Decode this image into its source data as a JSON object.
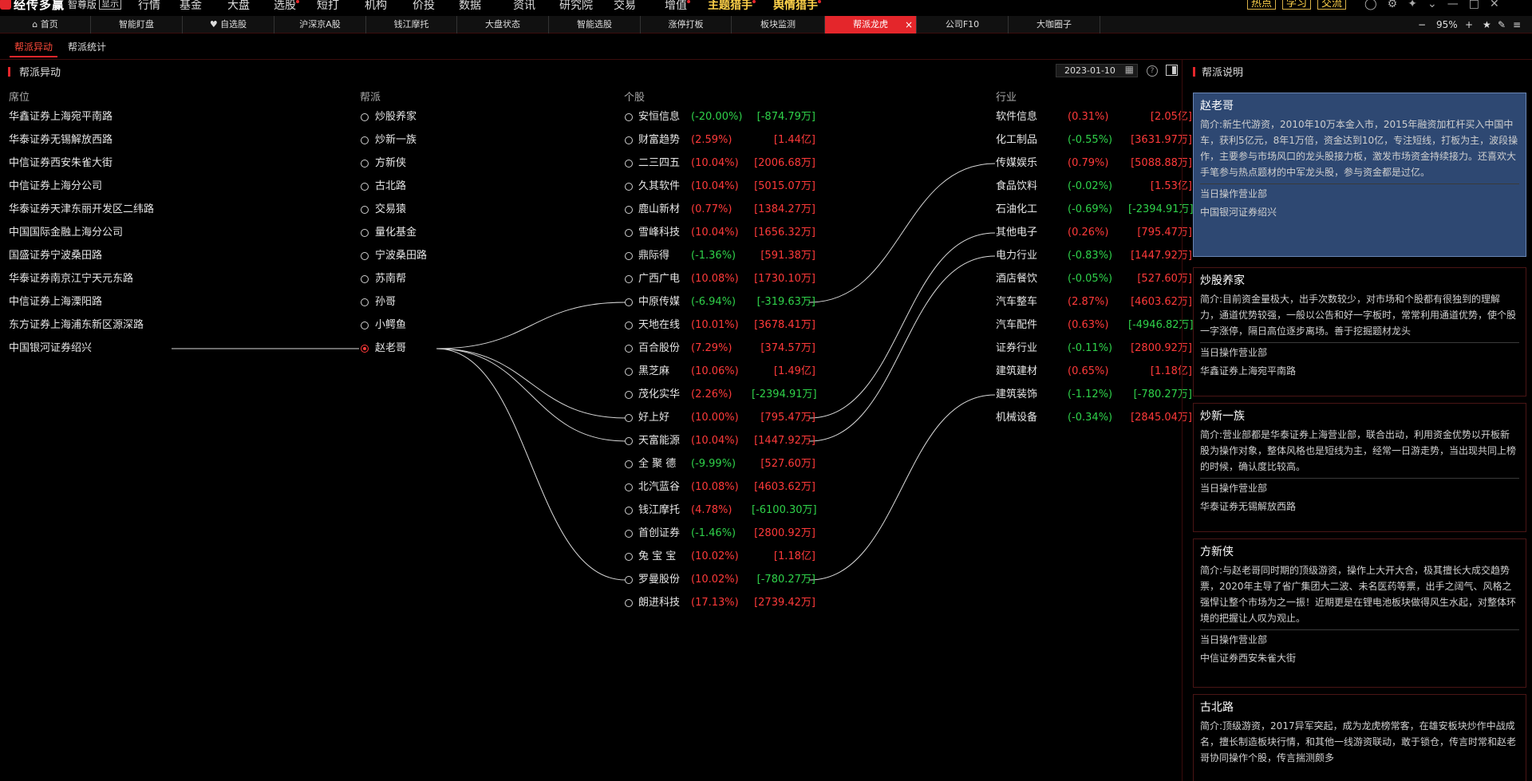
{
  "app": {
    "name": "经传多赢",
    "edition": "智尊版",
    "switch_label": "显示",
    "menu": [
      "行情",
      "基金",
      "大盘",
      "选股",
      "短打",
      "机构",
      "价投",
      "数据",
      "资讯",
      "研究院",
      "交易",
      "增值",
      "主题猎手",
      "舆情猎手"
    ],
    "right_buttons": [
      "热点",
      "学习",
      "交流"
    ],
    "window_icons": [
      "user-icon",
      "settings-icon",
      "pin-icon",
      "minimize-icon",
      "maximize-icon",
      "close-icon"
    ]
  },
  "tabs": [
    "首页",
    "智能盯盘",
    "自选股",
    "沪深京A股",
    "钱江摩托",
    "大盘状态",
    "智能选股",
    "涨停打板",
    "板块监测",
    "帮派龙虎",
    "公司F10",
    "大咖圈子"
  ],
  "active_tab": "帮派龙虎",
  "tab_controls": {
    "minus": "−",
    "zoom": "95%",
    "plus": "+"
  },
  "subtabs": [
    "帮派异动",
    "帮派统计"
  ],
  "panel": {
    "title": "帮派异动",
    "date": "2023-01-10",
    "columns": {
      "seat": "席位",
      "gang": "帮派",
      "stock": "个股",
      "industry": "行业"
    }
  },
  "seats": [
    "华鑫证券上海宛平南路",
    "华泰证券无锡解放西路",
    "中信证券西安朱雀大街",
    "中信证券上海分公司",
    "华泰证券天津东丽开发区二纬路",
    "中国国际金融上海分公司",
    "国盛证券宁波桑田路",
    "华泰证券南京江宁天元东路",
    "中信证券上海溧阳路",
    "东方证券上海浦东新区源深路",
    "中国银河证券绍兴"
  ],
  "gangs": [
    {
      "name": "炒股养家",
      "selected": false
    },
    {
      "name": "炒新一族",
      "selected": false
    },
    {
      "name": "方新侠",
      "selected": false
    },
    {
      "name": "古北路",
      "selected": false
    },
    {
      "name": "交易猿",
      "selected": false
    },
    {
      "name": "量化基金",
      "selected": false
    },
    {
      "name": "宁波桑田路",
      "selected": false
    },
    {
      "name": "苏南帮",
      "selected": false
    },
    {
      "name": "孙哥",
      "selected": false
    },
    {
      "name": "小鳄鱼",
      "selected": false
    },
    {
      "name": "赵老哥",
      "selected": true
    }
  ],
  "stocks": [
    {
      "name": "安恒信息",
      "pct": "(-20.00%)",
      "amt": "[-874.79万]",
      "pct_color": "green",
      "amt_color": "green"
    },
    {
      "name": "财富趋势",
      "pct": "(2.59%)",
      "amt": "[1.44亿]",
      "pct_color": "red",
      "amt_color": "red"
    },
    {
      "name": "二三四五",
      "pct": "(10.04%)",
      "amt": "[2006.68万]",
      "pct_color": "red",
      "amt_color": "red"
    },
    {
      "name": "久其软件",
      "pct": "(10.04%)",
      "amt": "[5015.07万]",
      "pct_color": "red",
      "amt_color": "red"
    },
    {
      "name": "鹿山新材",
      "pct": "(0.77%)",
      "amt": "[1384.27万]",
      "pct_color": "red",
      "amt_color": "red"
    },
    {
      "name": "雪峰科技",
      "pct": "(10.04%)",
      "amt": "[1656.32万]",
      "pct_color": "red",
      "amt_color": "red"
    },
    {
      "name": "鼎际得",
      "pct": "(-1.36%)",
      "amt": "[591.38万]",
      "pct_color": "green",
      "amt_color": "red"
    },
    {
      "name": "广西广电",
      "pct": "(10.08%)",
      "amt": "[1730.10万]",
      "pct_color": "red",
      "amt_color": "red"
    },
    {
      "name": "中原传媒",
      "pct": "(-6.94%)",
      "amt": "[-319.63万]",
      "pct_color": "green",
      "amt_color": "green"
    },
    {
      "name": "天地在线",
      "pct": "(10.01%)",
      "amt": "[3678.41万]",
      "pct_color": "red",
      "amt_color": "red"
    },
    {
      "name": "百合股份",
      "pct": "(7.29%)",
      "amt": "[374.57万]",
      "pct_color": "red",
      "amt_color": "red"
    },
    {
      "name": "黑芝麻",
      "pct": "(10.06%)",
      "amt": "[1.49亿]",
      "pct_color": "red",
      "amt_color": "red"
    },
    {
      "name": "茂化实华",
      "pct": "(2.26%)",
      "amt": "[-2394.91万]",
      "pct_color": "red",
      "amt_color": "green"
    },
    {
      "name": "好上好",
      "pct": "(10.00%)",
      "amt": "[795.47万]",
      "pct_color": "red",
      "amt_color": "red"
    },
    {
      "name": "天富能源",
      "pct": "(10.04%)",
      "amt": "[1447.92万]",
      "pct_color": "red",
      "amt_color": "red"
    },
    {
      "name": "全 聚 德",
      "pct": "(-9.99%)",
      "amt": "[527.60万]",
      "pct_color": "green",
      "amt_color": "red"
    },
    {
      "name": "北汽蓝谷",
      "pct": "(10.08%)",
      "amt": "[4603.62万]",
      "pct_color": "red",
      "amt_color": "red"
    },
    {
      "name": "钱江摩托",
      "pct": "(4.78%)",
      "amt": "[-6100.30万]",
      "pct_color": "red",
      "amt_color": "green"
    },
    {
      "name": "首创证券",
      "pct": "(-1.46%)",
      "amt": "[2800.92万]",
      "pct_color": "green",
      "amt_color": "red"
    },
    {
      "name": "兔 宝 宝",
      "pct": "(10.02%)",
      "amt": "[1.18亿]",
      "pct_color": "red",
      "amt_color": "red"
    },
    {
      "name": "罗曼股份",
      "pct": "(10.02%)",
      "amt": "[-780.27万]",
      "pct_color": "red",
      "amt_color": "green"
    },
    {
      "name": "朗进科技",
      "pct": "(17.13%)",
      "amt": "[2739.42万]",
      "pct_color": "red",
      "amt_color": "red"
    }
  ],
  "industries": [
    {
      "name": "软件信息",
      "pct": "(0.31%)",
      "amt": "[2.05亿]",
      "pct_color": "red",
      "amt_color": "red"
    },
    {
      "name": "化工制品",
      "pct": "(-0.55%)",
      "amt": "[3631.97万]",
      "pct_color": "green",
      "amt_color": "red"
    },
    {
      "name": "传媒娱乐",
      "pct": "(0.79%)",
      "amt": "[5088.88万]",
      "pct_color": "red",
      "amt_color": "red"
    },
    {
      "name": "食品饮料",
      "pct": "(-0.02%)",
      "amt": "[1.53亿]",
      "pct_color": "green",
      "amt_color": "red"
    },
    {
      "name": "石油化工",
      "pct": "(-0.69%)",
      "amt": "[-2394.91万]",
      "pct_color": "green",
      "amt_color": "green"
    },
    {
      "name": "其他电子",
      "pct": "(0.26%)",
      "amt": "[795.47万]",
      "pct_color": "red",
      "amt_color": "red"
    },
    {
      "name": "电力行业",
      "pct": "(-0.83%)",
      "amt": "[1447.92万]",
      "pct_color": "green",
      "amt_color": "red"
    },
    {
      "name": "酒店餐饮",
      "pct": "(-0.05%)",
      "amt": "[527.60万]",
      "pct_color": "green",
      "amt_color": "red"
    },
    {
      "name": "汽车整车",
      "pct": "(2.87%)",
      "amt": "[4603.62万]",
      "pct_color": "red",
      "amt_color": "red"
    },
    {
      "name": "汽车配件",
      "pct": "(0.63%)",
      "amt": "[-4946.82万]",
      "pct_color": "red",
      "amt_color": "green"
    },
    {
      "name": "证券行业",
      "pct": "(-0.11%)",
      "amt": "[2800.92万]",
      "pct_color": "green",
      "amt_color": "red"
    },
    {
      "name": "建筑建材",
      "pct": "(0.65%)",
      "amt": "[1.18亿]",
      "pct_color": "red",
      "amt_color": "red"
    },
    {
      "name": "建筑装饰",
      "pct": "(-1.12%)",
      "amt": "[-780.27万]",
      "pct_color": "green",
      "amt_color": "green"
    },
    {
      "name": "机械设备",
      "pct": "(-0.34%)",
      "amt": "[2845.04万]",
      "pct_color": "green",
      "amt_color": "red"
    }
  ],
  "links": {
    "seat_to_gang": [
      [
        10,
        10
      ]
    ],
    "gang_to_stock": [
      [
        10,
        8
      ],
      [
        10,
        13
      ],
      [
        10,
        14
      ],
      [
        10,
        20
      ]
    ],
    "stock_to_industry": [
      [
        8,
        2
      ],
      [
        13,
        5
      ],
      [
        14,
        6
      ],
      [
        20,
        12
      ]
    ]
  },
  "right_panel": {
    "title": "帮派说明",
    "sub_label": "当日操作营业部",
    "cards": [
      {
        "name": "赵老哥",
        "desc": "简介:新生代游资，2010年10万本金入市，2015年融资加杠杆买入中国中车，获利5亿元，8年1万倍，资金达到10亿，专注短线，打板为主，波段操作，主要参与市场风口的龙头股接力板，激发市场资金持续接力。还喜欢大手笔参与热点题材的中军龙头股，参与资金都是过亿。",
        "office": "中国银河证券绍兴",
        "selected": true
      },
      {
        "name": "炒股养家",
        "desc": "简介:目前资金量极大，出手次数较少，对市场和个股都有很独到的理解力，通道优势较强，一般以公告和好一字板时，常常利用通道优势，使个股一字涨停，隔日高位逐步离场。善于挖掘题材龙头",
        "office": "华鑫证券上海宛平南路",
        "selected": false
      },
      {
        "name": "炒新一族",
        "desc": "简介:营业部都是华泰证券上海营业部，联合出动，利用资金优势以开板新股为操作对象，整体风格也是短线为主，经常一日游走势，当出现共同上榜的时候，确认度比较高。",
        "office": "华泰证券无锡解放西路",
        "selected": false
      },
      {
        "name": "方新侠",
        "desc": "简介:与赵老哥同时期的顶级游资，操作上大开大合，极其擅长大成交趋势票，2020年主导了省广集团大二波、未名医药等票，出手之阔气、风格之强悍让整个市场为之一振！近期更是在锂电池板块做得风生水起，对整体环境的把握让人叹为观止。",
        "office": "中信证券西安朱雀大街",
        "selected": false
      },
      {
        "name": "古北路",
        "desc": "简介:顶级游资，2017异军突起，成为龙虎榜常客，在雄安板块炒作中战成名，擅长制造板块行情，和其他一线游资联动，敢于锁仓，传言时常和赵老哥协同操作个股，传言揣测颇多",
        "office": "",
        "selected": false
      }
    ]
  }
}
